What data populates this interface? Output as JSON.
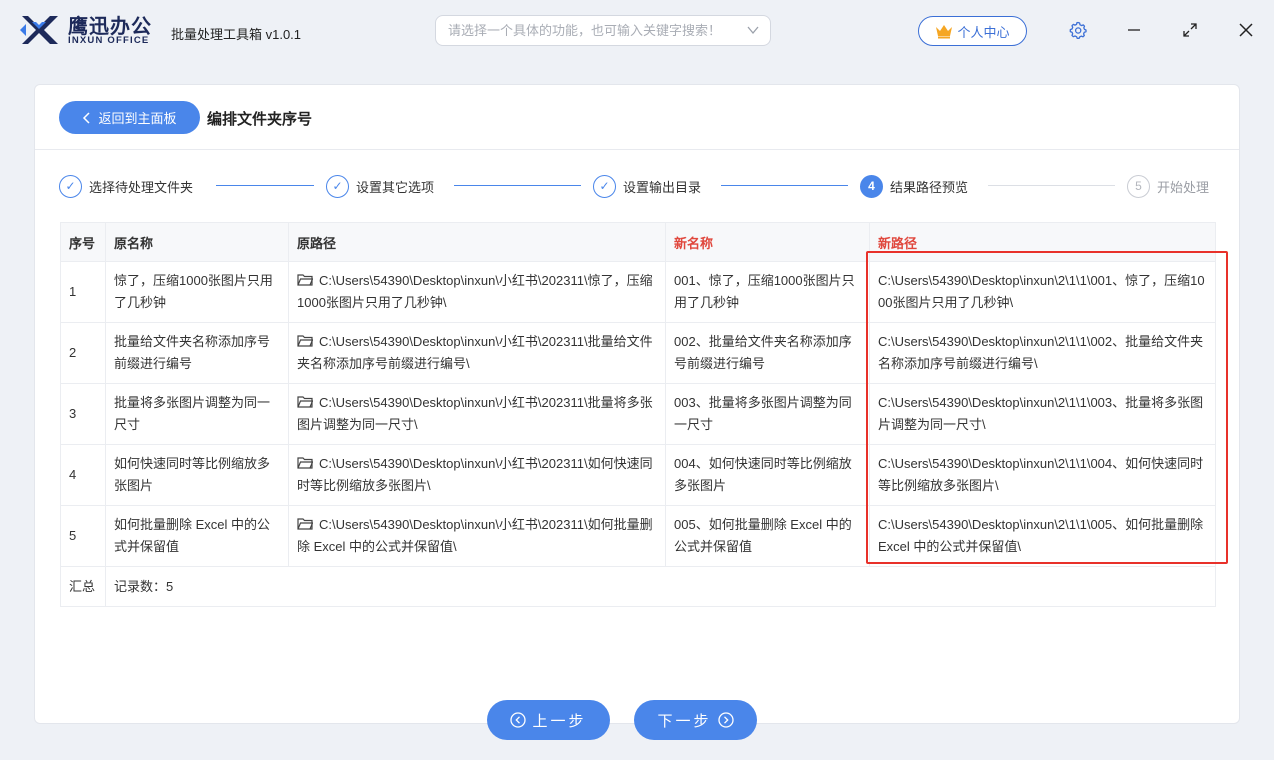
{
  "titlebar": {
    "brand_cn": "鹰迅办公",
    "brand_en": "INXUN OFFICE",
    "app_title": "批量处理工具箱 v1.0.1",
    "search_placeholder": "请选择一个具体的功能，也可输入关键字搜索！",
    "user_center": "个人中心"
  },
  "header": {
    "back_label": "返回到主面板",
    "page_title": "编排文件夹序号"
  },
  "steps": [
    {
      "num": "✓",
      "label": "选择待处理文件夹",
      "state": "done"
    },
    {
      "num": "✓",
      "label": "设置其它选项",
      "state": "done"
    },
    {
      "num": "✓",
      "label": "设置输出目录",
      "state": "done"
    },
    {
      "num": "4",
      "label": "结果路径预览",
      "state": "current"
    },
    {
      "num": "5",
      "label": "开始处理",
      "state": "pending"
    }
  ],
  "table": {
    "columns": [
      "序号",
      "原名称",
      "原路径",
      "新名称",
      "新路径"
    ],
    "rows": [
      {
        "idx": "1",
        "name": "惊了，压缩1000张图片只用了几秒钟",
        "path": "C:\\Users\\54390\\Desktop\\inxun\\小红书\\202311\\惊了，压缩1000张图片只用了几秒钟\\",
        "new_name": "001、惊了，压缩1000张图片只用了几秒钟",
        "new_path": "C:\\Users\\54390\\Desktop\\inxun\\2\\1\\1\\001、惊了，压缩1000张图片只用了几秒钟\\"
      },
      {
        "idx": "2",
        "name": "批量给文件夹名称添加序号前缀进行编号",
        "path": "C:\\Users\\54390\\Desktop\\inxun\\小红书\\202311\\批量给文件夹名称添加序号前缀进行编号\\",
        "new_name": "002、批量给文件夹名称添加序号前缀进行编号",
        "new_path": "C:\\Users\\54390\\Desktop\\inxun\\2\\1\\1\\002、批量给文件夹名称添加序号前缀进行编号\\"
      },
      {
        "idx": "3",
        "name": "批量将多张图片调整为同一尺寸",
        "path": "C:\\Users\\54390\\Desktop\\inxun\\小红书\\202311\\批量将多张图片调整为同一尺寸\\",
        "new_name": "003、批量将多张图片调整为同一尺寸",
        "new_path": "C:\\Users\\54390\\Desktop\\inxun\\2\\1\\1\\003、批量将多张图片调整为同一尺寸\\"
      },
      {
        "idx": "4",
        "name": "如何快速同时等比例缩放多张图片",
        "path": "C:\\Users\\54390\\Desktop\\inxun\\小红书\\202311\\如何快速同时等比例缩放多张图片\\",
        "new_name": "004、如何快速同时等比例缩放多张图片",
        "new_path": "C:\\Users\\54390\\Desktop\\inxun\\2\\1\\1\\004、如何快速同时等比例缩放多张图片\\"
      },
      {
        "idx": "5",
        "name": "如何批量删除 Excel 中的公式并保留值",
        "path": "C:\\Users\\54390\\Desktop\\inxun\\小红书\\202311\\如何批量删除 Excel 中的公式并保留值\\",
        "new_name": "005、如何批量删除 Excel 中的公式并保留值",
        "new_path": "C:\\Users\\54390\\Desktop\\inxun\\2\\1\\1\\005、如何批量删除 Excel 中的公式并保留值\\"
      }
    ],
    "summary_label": "汇总",
    "summary_value": "记录数：5"
  },
  "footer": {
    "prev_label": "上一步",
    "next_label": "下一步"
  },
  "colors": {
    "accent": "#4a86ea",
    "highlight": "#e8312a",
    "new_col_header": "#e0473d"
  }
}
